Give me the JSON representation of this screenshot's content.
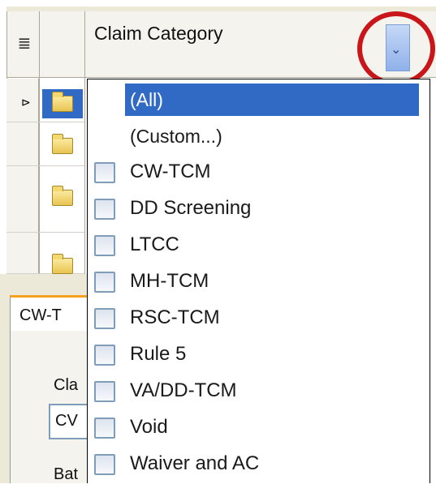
{
  "header": {
    "column_title": "Claim Category",
    "column_icon": "list-icon"
  },
  "dropdown": {
    "special_options": [
      "(All)",
      "(Custom...)"
    ],
    "selected": "(All)",
    "items": [
      {
        "label": "CW-TCM",
        "checked": false
      },
      {
        "label": "DD Screening",
        "checked": false
      },
      {
        "label": "LTCC",
        "checked": false
      },
      {
        "label": "MH-TCM",
        "checked": false
      },
      {
        "label": "RSC-TCM",
        "checked": false
      },
      {
        "label": "Rule 5",
        "checked": false
      },
      {
        "label": "VA/DD-TCM",
        "checked": false
      },
      {
        "label": "Void",
        "checked": false
      },
      {
        "label": "Waiver and AC",
        "checked": false
      }
    ]
  },
  "lower_panel": {
    "tab_label": "CW-T",
    "field_label": "Cla",
    "field_value": "CV",
    "second_label": "Bat"
  },
  "colors": {
    "selection": "#316ac5",
    "highlight_circle": "#c8161a",
    "tab_accent": "#f7a11d"
  }
}
